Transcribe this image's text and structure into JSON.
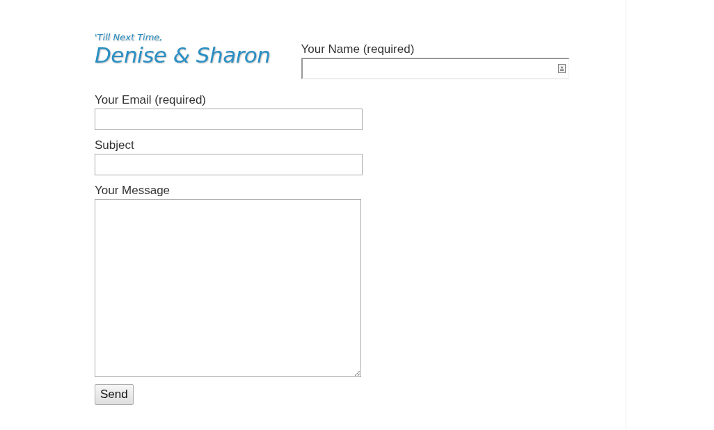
{
  "logo": {
    "tagline": "'Till Next Time,",
    "title": "Denise & Sharon"
  },
  "fields": [
    {
      "label": "Your Name (required)",
      "kind": "text",
      "contact_icon": true
    },
    {
      "label": "Your Email (required)",
      "kind": "text",
      "contact_icon": false
    },
    {
      "label": "Subject",
      "kind": "text",
      "contact_icon": false
    },
    {
      "label": "Your Message",
      "kind": "textarea",
      "contact_icon": false
    }
  ],
  "submit": {
    "label": "Send"
  }
}
